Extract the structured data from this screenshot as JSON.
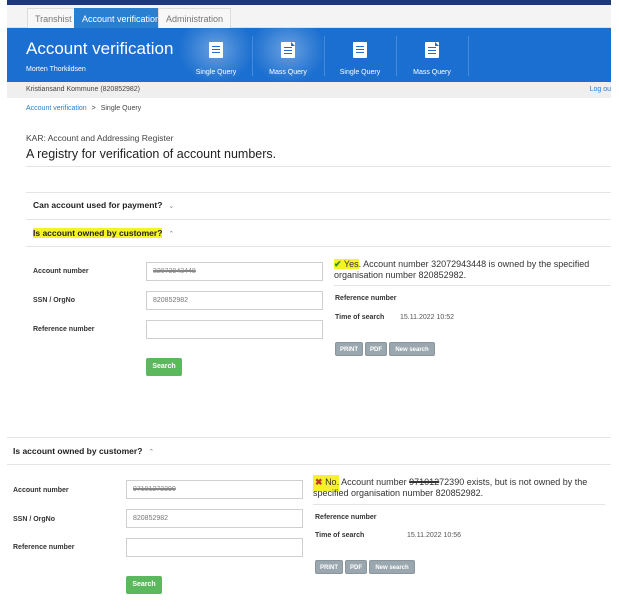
{
  "nav": {
    "tabs": [
      {
        "label": "Transhist",
        "active": false
      },
      {
        "label": "Account verification",
        "active": true
      },
      {
        "label": "Administration",
        "active": false
      }
    ]
  },
  "banner": {
    "title": "Account verification",
    "user": "Morten Thorkildsen",
    "buttons": [
      {
        "label": "Single Query",
        "icon": "list-icon",
        "highlighted": true
      },
      {
        "label": "Mass Query",
        "icon": "document-icon",
        "highlighted": true
      },
      {
        "label": "Single Query",
        "icon": "list-icon",
        "highlighted": false
      },
      {
        "label": "Mass Query",
        "icon": "document-icon",
        "highlighted": false
      }
    ]
  },
  "org_bar": {
    "organisation": "Kristiansand Kommune (820852982)",
    "logout": "Log ou"
  },
  "breadcrumb": {
    "parent": "Account verification",
    "separator": ">",
    "current": "Single Query"
  },
  "intro": {
    "subtitle": "KAR: Account and Addressing Register",
    "headline": "A registry for verification of account numbers."
  },
  "sections": {
    "payment": {
      "label": "Can account used for payment?",
      "chevron": "⌄"
    },
    "owned": {
      "label": "Is account owned by customer?",
      "chevron": "⌃"
    }
  },
  "form_labels": {
    "account": "Account number",
    "ssn": "SSN / OrgNo",
    "reference": "Reference number",
    "search": "Search"
  },
  "query1": {
    "account_value": "32072943448",
    "ssn_value": "820852982",
    "reference_value": "",
    "result_word": "Yes",
    "result_icon": "✔",
    "result_text": ". Account number 32072943448 is owned by the specified organisation number 820852982.",
    "reference_label": "Reference number",
    "time_label": "Time of search",
    "time_value": "15.11.2022 10:52"
  },
  "query2": {
    "section_label": "Is account owned by customer?",
    "account_value": "97101272390",
    "ssn_value": "820852982",
    "reference_value": "",
    "result_word": "No.",
    "result_icon": "✖",
    "result_text_pre": " Account number ",
    "result_redacted": "971012",
    "result_text_post": "72390 exists, but is not owned by the specified organisation number 820852982.",
    "reference_label": "Reference number",
    "time_label": "Time of search",
    "time_value": "15.11.2022 10:56"
  },
  "actions": {
    "print": "PRINT",
    "pdf": "PDF",
    "new_search": "New search"
  },
  "colors": {
    "brand_blue": "#1b6fd0",
    "highlight": "#f6f22a",
    "search_green": "#5cb85c",
    "action_gray": "#9aa7ae"
  }
}
